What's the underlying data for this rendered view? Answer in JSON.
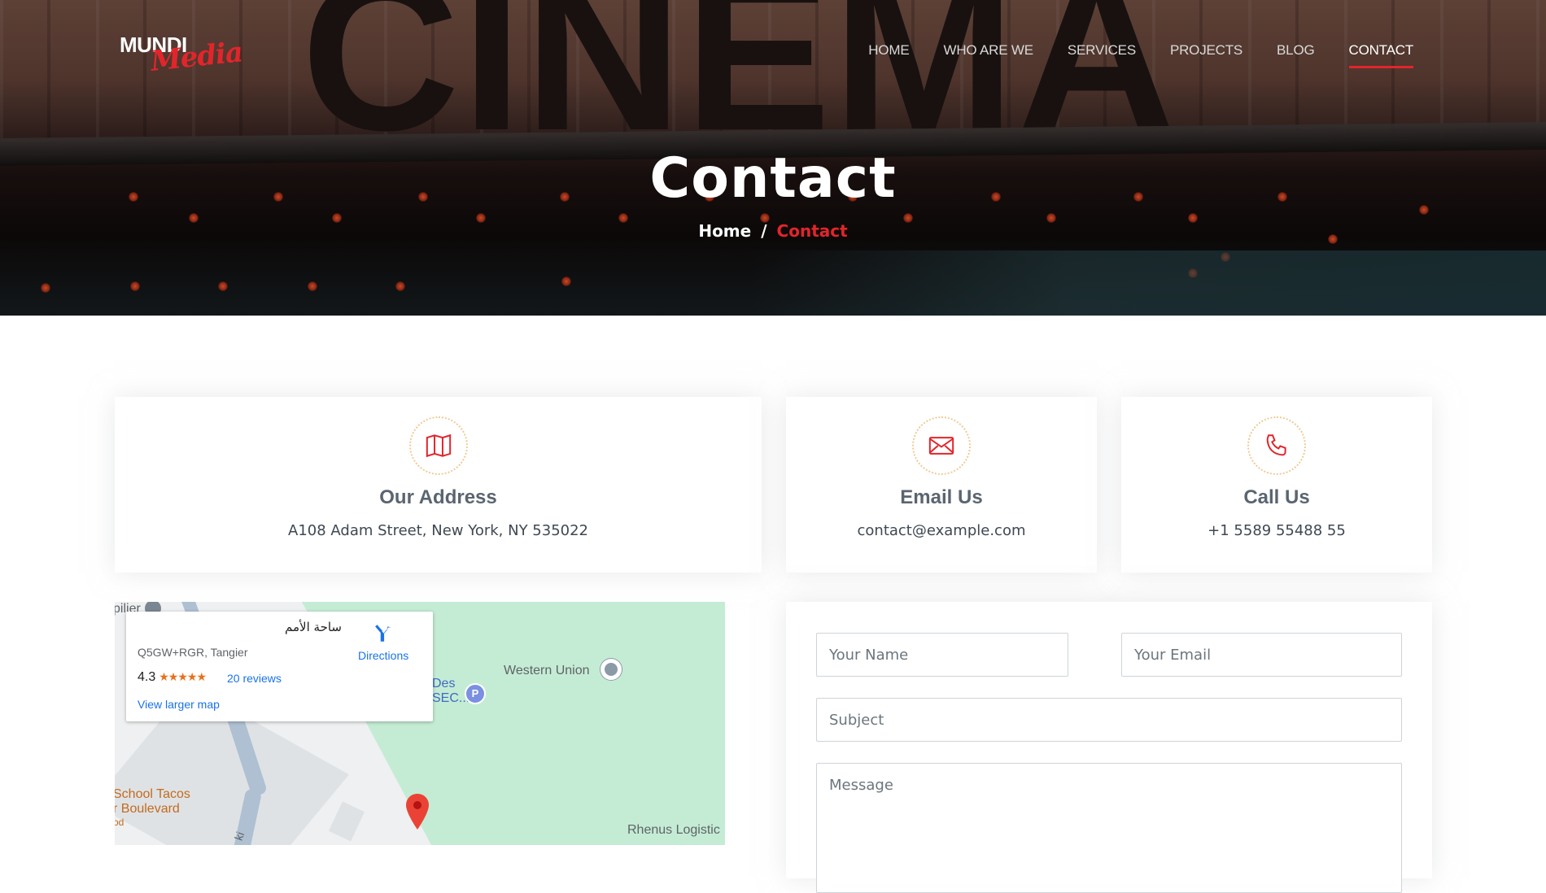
{
  "brand": {
    "name_part1": "MUNDI",
    "name_part2": "Media",
    "accent": "#e2252b"
  },
  "hero": {
    "backdrop_sign": "CINEMA",
    "title": "Contact",
    "breadcrumb": {
      "home": "Home",
      "separator": "/",
      "current": "Contact"
    }
  },
  "nav": {
    "items": [
      {
        "label": "HOME"
      },
      {
        "label": "WHO ARE WE"
      },
      {
        "label": "SERVICES"
      },
      {
        "label": "PROJECTS"
      },
      {
        "label": "BLOG"
      },
      {
        "label": "CONTACT",
        "active": true
      }
    ]
  },
  "cards": {
    "address": {
      "icon": "map-icon",
      "title": "Our Address",
      "text": "A108 Adam Street, New York, NY 535022"
    },
    "email": {
      "icon": "envelope-icon",
      "title": "Email Us",
      "text": "contact@example.com"
    },
    "call": {
      "icon": "phone-icon",
      "title": "Call Us",
      "text": "+1 5589 55488 55"
    }
  },
  "map": {
    "popup": {
      "place_name": "ساحة الأمم",
      "plus_code": "Q5GW+RGR, Tangier",
      "rating": "4.3",
      "stars": "★★★★★",
      "reviews": "20 reviews",
      "larger_map": "View larger map",
      "directions": "Directions"
    },
    "labels": {
      "western_union": "Western Union",
      "des_sec": "Des\nSEC...",
      "school_tacos": "School Tacos",
      "boulevard": "r Boulevard",
      "food": "od",
      "rhenus": "Rhenus Logistic",
      "top_left": "pilier",
      "parking": "P",
      "street": "ki"
    }
  },
  "form": {
    "name_placeholder": "Your Name",
    "email_placeholder": "Your Email",
    "subject_placeholder": "Subject",
    "message_placeholder": "Message"
  }
}
